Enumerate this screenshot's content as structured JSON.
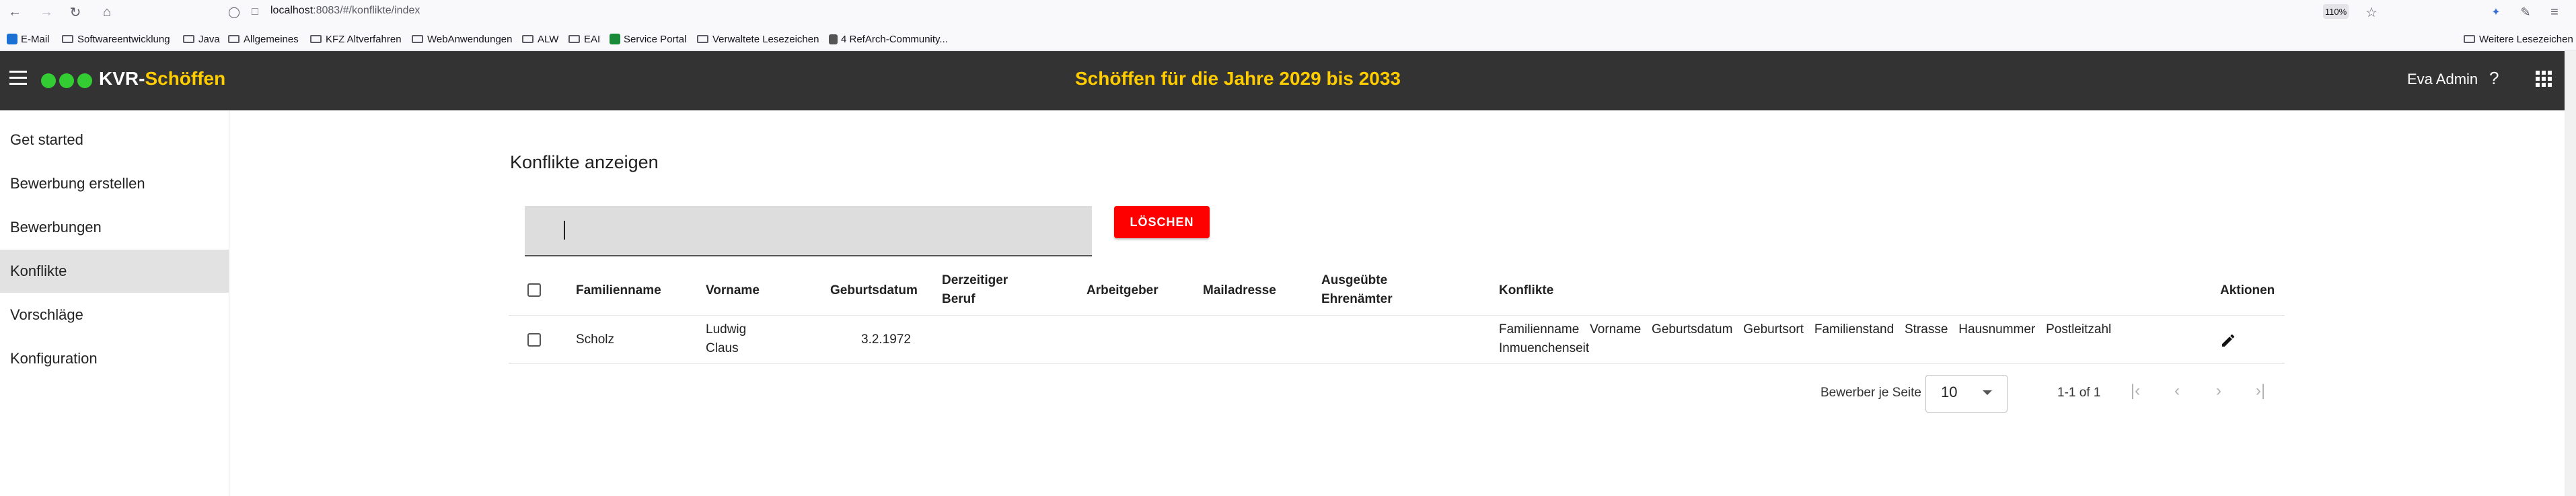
{
  "browser": {
    "url_host": "localhost",
    "url_rest": ":8083/#/konflikte/index",
    "zoom": "110%",
    "bookmarks": [
      {
        "label": "E-Mail",
        "icon": "outlook-icon"
      },
      {
        "label": "Softwareentwicklung",
        "icon": "folder-icon"
      },
      {
        "label": "Java",
        "icon": "folder-icon"
      },
      {
        "label": "Allgemeines",
        "icon": "folder-icon"
      },
      {
        "label": "KFZ Altverfahren",
        "icon": "folder-icon"
      },
      {
        "label": "WebAnwendungen",
        "icon": "folder-icon"
      },
      {
        "label": "ALW",
        "icon": "folder-icon"
      },
      {
        "label": "EAI",
        "icon": "folder-icon"
      },
      {
        "label": "Service Portal",
        "icon": "portal-icon"
      },
      {
        "label": "Verwaltete Lesezeichen",
        "icon": "folder-icon"
      },
      {
        "label": "4 RefArch-Community...",
        "icon": "page-icon"
      }
    ],
    "other_bookmarks": "Weitere Lesezeichen"
  },
  "header": {
    "brand_prefix": "KVR-",
    "brand_accent": "Schöffen",
    "title": "Schöffen für die Jahre 2029 bis 2033",
    "user": "Eva Admin",
    "help": "?"
  },
  "sidebar": {
    "items": [
      {
        "label": "Get started",
        "active": false
      },
      {
        "label": "Bewerbung erstellen",
        "active": false
      },
      {
        "label": "Bewerbungen",
        "active": false
      },
      {
        "label": "Konflikte",
        "active": true
      },
      {
        "label": "Vorschläge",
        "active": false
      },
      {
        "label": "Konfiguration",
        "active": false
      }
    ]
  },
  "main": {
    "heading": "Konflikte anzeigen",
    "search_value": "",
    "delete_label": "LÖSCHEN",
    "columns": {
      "familienname": "Familienname",
      "vorname": "Vorname",
      "geburtsdatum": "Geburtsdatum",
      "beruf_1": "Derzeitiger",
      "beruf_2": "Beruf",
      "arbeitgeber": "Arbeitgeber",
      "mailadresse": "Mailadresse",
      "ehrenaemter_1": "Ausgeübte",
      "ehrenaemter_2": "Ehrenämter",
      "konflikte": "Konflikte",
      "aktionen": "Aktionen"
    },
    "rows": [
      {
        "familienname": "Scholz",
        "vorname_1": "Ludwig",
        "vorname_2": "Claus",
        "geburtsdatum": "3.2.1972",
        "beruf": "",
        "arbeitgeber": "",
        "mailadresse": "",
        "ehrenaemter": "",
        "konflikte_1": "Familienname   Vorname   Geburtsdatum   Geburtsort   Familienstand   Strasse   Hausnummer   Postleitzahl",
        "konflikte_2": "Inmuenchenseit"
      }
    ],
    "pagination": {
      "per_page_label": "Bewerber je Seite",
      "per_page_value": "10",
      "range": "1-1 of 1"
    }
  },
  "colors": {
    "header_bg": "#333333",
    "accent_yellow": "#ffcc00",
    "brand_dots": "#33cc33",
    "delete_red": "#ff0000",
    "active_nav_bg": "#e2e2e2"
  }
}
